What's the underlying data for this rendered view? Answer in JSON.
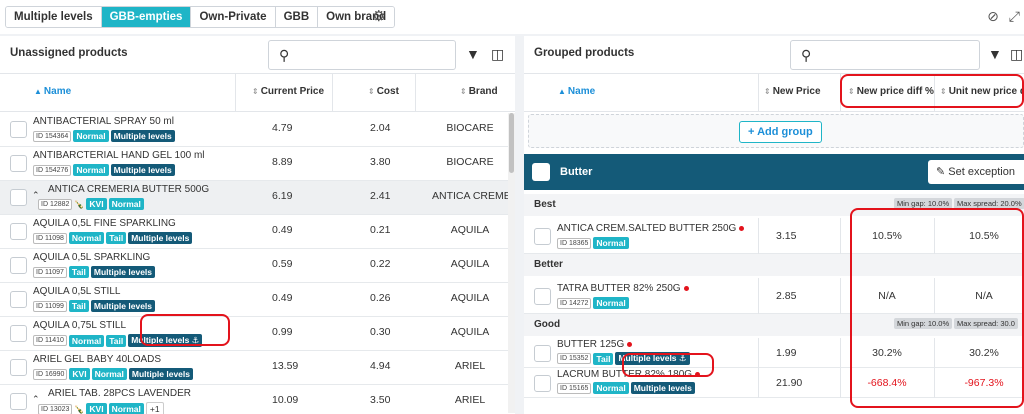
{
  "tabs": [
    {
      "label": "Multiple levels",
      "active": false
    },
    {
      "label": "GBB-empties",
      "active": true
    },
    {
      "label": "Own-Private",
      "active": false
    },
    {
      "label": "GBB",
      "active": false
    },
    {
      "label": "Own brand",
      "active": false
    }
  ],
  "left_panel": {
    "title": "Unassigned products",
    "search_placeholder": "",
    "columns": {
      "name": "Name",
      "current_price": "Current Price",
      "cost": "Cost",
      "brand": "Brand"
    },
    "rows": [
      {
        "name": "ANTIBACTERIAL SPRAY 50 ml",
        "id": "ID 154364",
        "tags": [
          "Normal",
          "Multiple levels"
        ],
        "price": "4.79",
        "cost": "2.04",
        "brand": "BIOCARE"
      },
      {
        "name": "ANTIBARCTERIAL HAND GEL 100 ml",
        "id": "ID 154276",
        "tags": [
          "Normal",
          "Multiple levels"
        ],
        "price": "8.89",
        "cost": "3.80",
        "brand": "BIOCARE"
      },
      {
        "name": "ANTICA CREMERIA BUTTER 500G",
        "id": "ID 12882",
        "tags": [
          "KVI",
          "Normal"
        ],
        "price": "6.19",
        "cost": "2.41",
        "brand": "ANTICA CREMER"
      },
      {
        "name": "AQUILA 0,5L FINE SPARKLING",
        "id": "ID 11098",
        "tags": [
          "Normal",
          "Tail",
          "Multiple levels"
        ],
        "price": "0.49",
        "cost": "0.21",
        "brand": "AQUILA"
      },
      {
        "name": "AQUILA 0,5L SPARKLING",
        "id": "ID 11097",
        "tags": [
          "Tail",
          "Multiple levels"
        ],
        "price": "0.59",
        "cost": "0.22",
        "brand": "AQUILA"
      },
      {
        "name": "AQUILA 0,5L STILL",
        "id": "ID 11099",
        "tags": [
          "Tail",
          "Multiple levels"
        ],
        "price": "0.49",
        "cost": "0.26",
        "brand": "AQUILA"
      },
      {
        "name": "AQUILA 0,75L STILL",
        "id": "ID 11410",
        "tags": [
          "Normal",
          "Tail",
          "Multiple levels ⚓"
        ],
        "price": "0.99",
        "cost": "0.30",
        "brand": "AQUILA"
      },
      {
        "name": "ARIEL GEL BABY 40LOADS",
        "id": "ID 16990",
        "tags": [
          "KVI",
          "Normal",
          "Multiple levels"
        ],
        "price": "13.59",
        "cost": "4.94",
        "brand": "ARIEL"
      },
      {
        "name": "ARIEL TAB. 28PCS LAVENDER",
        "id": "ID 13023",
        "tags": [
          "KVI",
          "Normal",
          "+1"
        ],
        "price": "10.09",
        "cost": "3.50",
        "brand": "ARIEL"
      }
    ]
  },
  "right_panel": {
    "title": "Grouped products",
    "columns": {
      "name": "Name",
      "new_price": "New Price",
      "new_price_diff": "New price diff %",
      "unit_new_price_diff": "Unit new price dif"
    },
    "add_group_label": "+ Add group",
    "group": {
      "name": "Butter",
      "set_exception_label": "Set exception"
    },
    "tiers": [
      {
        "name": "Best",
        "min_gap": "Min gap: 10.0%",
        "max_spread": "Max spread: 20.0%",
        "items": [
          {
            "name": "ANTICA CREM.SALTED BUTTER 250G",
            "id": "ID 18365",
            "tags": [
              "Normal"
            ],
            "new_price": "3.15",
            "diff": "10.5%",
            "unit_diff": "10.5%"
          }
        ]
      },
      {
        "name": "Better",
        "min_gap": "",
        "max_spread": "",
        "items": [
          {
            "name": "TATRA BUTTER 82% 250G",
            "id": "ID 14272",
            "tags": [
              "Normal"
            ],
            "new_price": "2.85",
            "diff": "N/A",
            "unit_diff": "N/A"
          }
        ]
      },
      {
        "name": "Good",
        "min_gap": "Min gap: 10.0%",
        "max_spread": "Max spread: 30.0",
        "items": [
          {
            "name": "BUTTER 125G",
            "id": "ID 15352",
            "tags": [
              "Tail",
              "Multiple levels ⚓"
            ],
            "new_price": "1.99",
            "diff": "30.2%",
            "unit_diff": "30.2%"
          },
          {
            "name": "LACRUM BUTTER 82% 180G",
            "id": "ID 15165",
            "tags": [
              "Normal",
              "Multiple levels"
            ],
            "new_price": "21.90",
            "diff": "-668.4%",
            "unit_diff": "-967.3%"
          }
        ]
      }
    ]
  },
  "colors": {
    "accent": "#1fb5c7",
    "dark": "#145a78",
    "annotation": "#e3131c"
  }
}
